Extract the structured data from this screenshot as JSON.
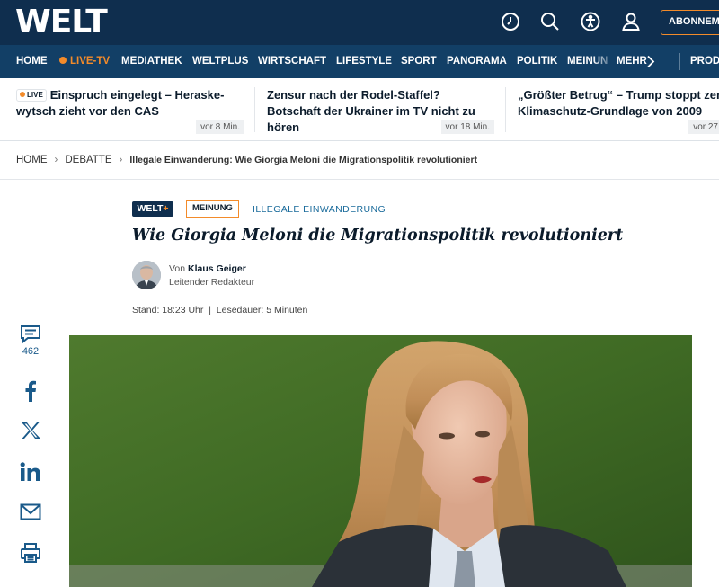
{
  "header": {
    "logo": "WELT",
    "icons": [
      "clock-icon",
      "search-icon",
      "accessibility-icon",
      "user-icon"
    ],
    "subscribe_label": "ABONNEM"
  },
  "nav": {
    "items": [
      "HOME",
      "LIVE-TV",
      "MEDIATHEK",
      "WELTPLUS",
      "WIRTSCHAFT",
      "LIFESTYLE",
      "SPORT",
      "PANORAMA",
      "POLITIK",
      "MEINUN",
      "MEHR"
    ],
    "right_item": "PROD"
  },
  "teasers": [
    {
      "badge": "LIVE",
      "title": "Einspruch eingelegt – Heraske-wytsch zieht vor den CAS",
      "time": "vor 8 Min."
    },
    {
      "title": "Zensur nach der Rodel-Staffel? Botschaft der Ukrainer im TV nicht zu hören",
      "time": "vor 18 Min."
    },
    {
      "title": "„Größter Betrug“ – Trump stoppt zent Klimaschutz-Grundlage von 2009",
      "time": "vor 27"
    }
  ],
  "breadcrumb": {
    "items": [
      "HOME",
      "DEBATTE"
    ],
    "current": "Illegale Einwanderung: Wie Giorgia Meloni die Migrationspolitik revolutioniert"
  },
  "article": {
    "badge_weltplus": "WELT",
    "badge_plus": "+",
    "badge_meinung": "MEINUNG",
    "topic": "ILLEGALE EINWANDERUNG",
    "headline": "Wie Giorgia Meloni die Migrationspolitik revolutioniert",
    "author_prefix": "Von",
    "author_name": "Klaus Geiger",
    "author_role": "Leitender Redakteur",
    "meta": "Stand: 18:23 Uhr  |  Lesedauer: 5 Minuten"
  },
  "social": {
    "comment_count": "462",
    "icons": [
      "comment-icon",
      "facebook-icon",
      "x-icon",
      "linkedin-icon",
      "mail-icon",
      "print-icon"
    ]
  },
  "colors": {
    "header_bg": "#0f2e4e",
    "nav_bg": "#123f66",
    "accent": "#f38b2a",
    "link": "#1a6b9b"
  }
}
